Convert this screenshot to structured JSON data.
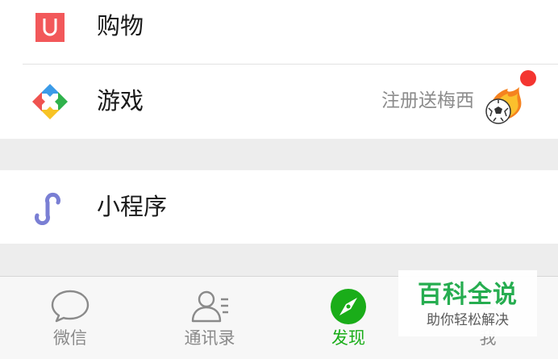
{
  "menu": {
    "shopping": {
      "label": "购物",
      "icon": "shopping-bag-icon",
      "icon_color": "#f2585a"
    },
    "games": {
      "label": "游戏",
      "icon": "games-icon",
      "promo_text": "注册送梅西",
      "promo_icon": "soccer-ball-icon",
      "has_red_dot": true,
      "red_dot_color": "#f43530"
    },
    "mini_programs": {
      "label": "小程序",
      "icon": "mini-program-icon",
      "icon_color": "#7a7fd4"
    }
  },
  "tabbar": {
    "tabs": [
      {
        "label": "微信",
        "icon": "chat-bubble-icon",
        "active": false
      },
      {
        "label": "通讯录",
        "icon": "contacts-icon",
        "active": false
      },
      {
        "label": "发现",
        "icon": "compass-icon",
        "active": true
      },
      {
        "label": "我",
        "icon": "person-icon",
        "active": false
      }
    ],
    "active_color": "#1aad19",
    "inactive_color": "#8a8a8a"
  },
  "watermark": {
    "title": "百科全说",
    "subtitle": "助你轻松解决"
  }
}
